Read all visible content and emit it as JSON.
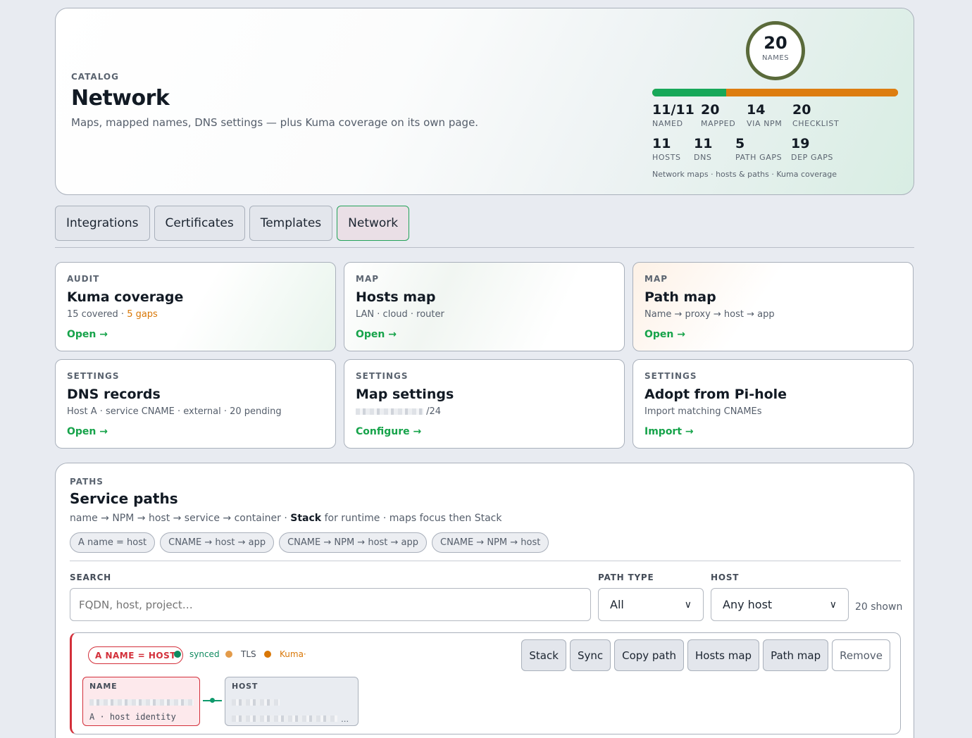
{
  "hero": {
    "eyebrow": "CATALOG",
    "title": "Network",
    "subtitle": "Maps, mapped names, DNS settings — plus Kuma coverage on its own page.",
    "ring": {
      "value": "20",
      "label": "NAMES"
    },
    "progress": {
      "green_fraction": 0.3,
      "colors": {
        "green": "#17a859",
        "orange": "#dd7d10"
      }
    },
    "stats": [
      {
        "value": "11/11",
        "label": "NAMED"
      },
      {
        "value": "20",
        "label": "MAPPED"
      },
      {
        "value": "14",
        "label": "VIA NPM"
      },
      {
        "value": "20",
        "label": "CHECKLIST"
      },
      {
        "value": "11",
        "label": "HOSTS"
      },
      {
        "value": "11",
        "label": "DNS"
      },
      {
        "value": "5",
        "label": "PATH GAPS"
      },
      {
        "value": "19",
        "label": "DEP GAPS"
      }
    ],
    "footer": "Network maps · hosts & paths · Kuma coverage"
  },
  "tabs": [
    {
      "label": "Integrations",
      "active": false
    },
    {
      "label": "Certificates",
      "active": false
    },
    {
      "label": "Templates",
      "active": false
    },
    {
      "label": "Network",
      "active": true
    }
  ],
  "cards": [
    {
      "eyebrow": "AUDIT",
      "title": "Kuma coverage",
      "desc": "15 covered · ",
      "desc_warn": "5 gaps",
      "action": "Open →"
    },
    {
      "eyebrow": "MAP",
      "title": "Hosts map",
      "desc": "LAN · cloud · router",
      "action": "Open →"
    },
    {
      "eyebrow": "MAP",
      "title": "Path map",
      "desc": "Name → proxy → host → app",
      "action": "Open →"
    },
    {
      "eyebrow": "SETTINGS",
      "title": "DNS records",
      "desc": "Host A · service CNAME · external · 20 pending",
      "action": "Open →"
    },
    {
      "eyebrow": "SETTINGS",
      "title": "Map settings",
      "desc": "/24",
      "action": "Configure →"
    },
    {
      "eyebrow": "SETTINGS",
      "title": "Adopt from Pi-hole",
      "desc": "Import matching CNAMEs",
      "action": "Import →"
    }
  ],
  "paths": {
    "eyebrow": "PATHS",
    "title": "Service paths",
    "desc_pre": "name → NPM → host → service → container · ",
    "desc_bold": "Stack",
    "desc_post": " for runtime · maps focus then Stack",
    "chips": [
      "A name = host",
      "CNAME → host → app",
      "CNAME → NPM → host → app",
      "CNAME → NPM → host"
    ],
    "filters": {
      "search_label": "SEARCH",
      "search_placeholder": "FQDN, host, project…",
      "type_label": "PATH TYPE",
      "type_value": "All",
      "host_label": "HOST",
      "host_value": "Any host",
      "shown": "20 shown"
    },
    "row": {
      "badge": "A NAME = HOST",
      "statuses": [
        {
          "label": "synced",
          "color": "#0f8a5f"
        },
        {
          "label": "TLS",
          "color": "#e39b4a"
        },
        {
          "label": "Kuma·",
          "color": "#d97706"
        }
      ],
      "buttons": [
        "Stack",
        "Sync",
        "Copy path",
        "Hosts map",
        "Path map",
        "Remove"
      ],
      "name_box": {
        "label": "NAME",
        "meta": "A · host identity"
      },
      "host_box": {
        "label": "HOST",
        "ellipsis": "…"
      }
    }
  }
}
